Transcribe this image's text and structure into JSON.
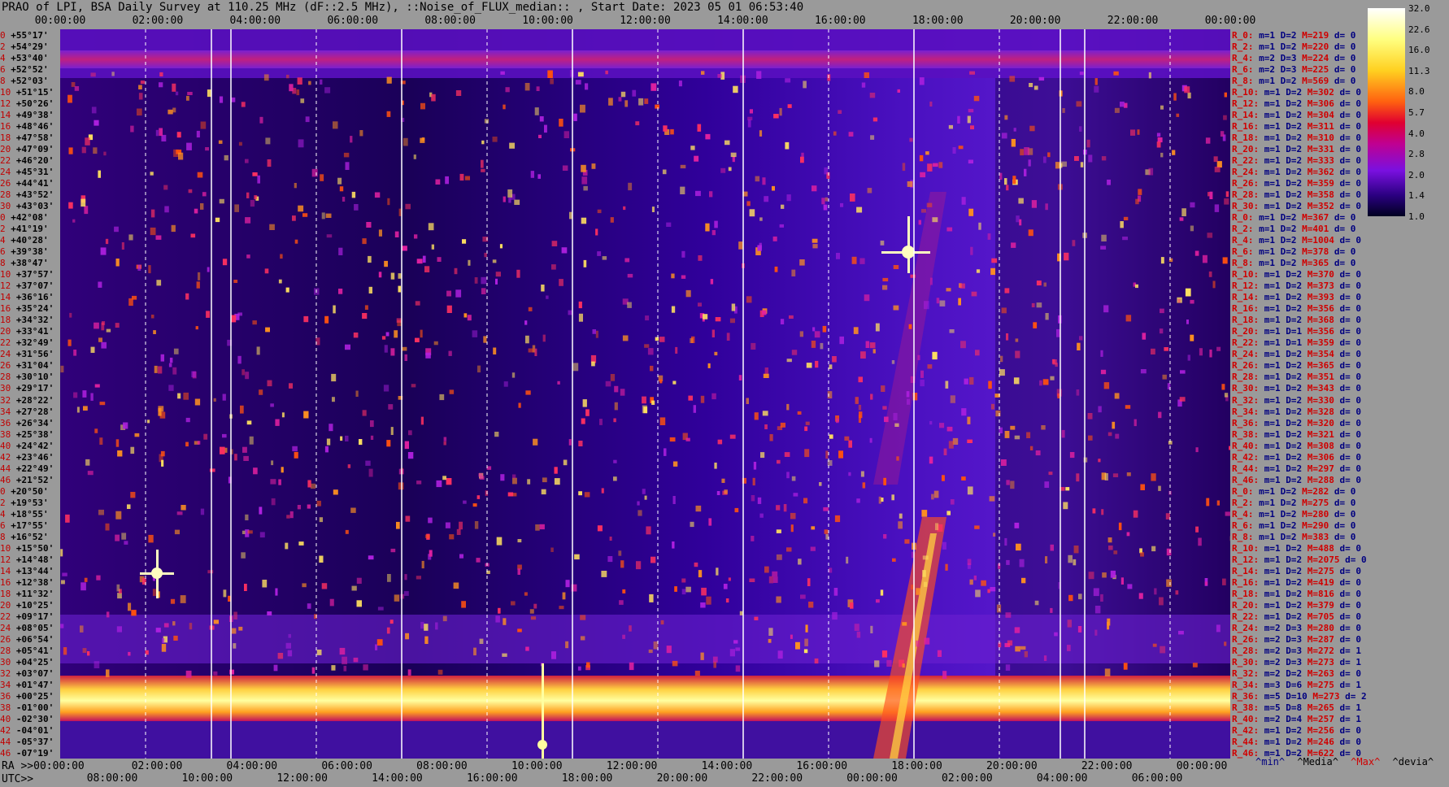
{
  "title": "PRAO of LPI, BSA Daily Survey at 110.25 MHz (dF::2.5 MHz), ::Noise_of_FLUX_median:: , Start Date: 2023 05 01 06:53:40",
  "chart_data": {
    "type": "heatmap",
    "title": "PRAO of LPI, BSA Daily Survey at 110.25 MHz (dF::2.5 MHz), ::Noise_of_FLUX_median:: , Start Date: 2023 05 01 06:53:40",
    "x_top_ticks": [
      "00:00:00",
      "02:00:00",
      "04:00:00",
      "06:00:00",
      "08:00:00",
      "10:00:00",
      "12:00:00",
      "14:00:00",
      "16:00:00",
      "18:00:00",
      "20:00:00",
      "22:00:00",
      "00:00:00"
    ],
    "ra_label": "RA >>00:00:00",
    "ra_ticks": [
      "02:00:00",
      "04:00:00",
      "06:00:00",
      "08:00:00",
      "10:00:00",
      "12:00:00",
      "14:00:00",
      "16:00:00",
      "18:00:00",
      "20:00:00",
      "22:00:00",
      "00:00:00"
    ],
    "utc_label": "UTC>>",
    "utc_ticks": [
      "08:00:00",
      "10:00:00",
      "12:00:00",
      "14:00:00",
      "16:00:00",
      "18:00:00",
      "20:00:00",
      "22:00:00",
      "00:00:00",
      "02:00:00",
      "04:00:00",
      "06:00:00"
    ],
    "colorbar_ticks": [
      "32.0",
      "22.6",
      "16.0",
      "11.3",
      "8.0",
      "5.7",
      "4.0",
      "2.8",
      "2.0",
      "1.4",
      "1.0"
    ],
    "declinations": [
      "+55°17'",
      "+54°29'",
      "+53°40'",
      "+52°52'",
      "+52°03'",
      "+51°15'",
      "+50°26'",
      "+49°38'",
      "+48°46'",
      "+47°58'",
      "+47°09'",
      "+46°20'",
      "+45°31'",
      "+44°41'",
      "+43°52'",
      "+43°03'",
      "+42°08'",
      "+41°19'",
      "+40°28'",
      "+39°38'",
      "+38°47'",
      "+37°57'",
      "+37°07'",
      "+36°16'",
      "+35°24'",
      "+34°32'",
      "+33°41'",
      "+32°49'",
      "+31°56'",
      "+31°04'",
      "+30°10'",
      "+29°17'",
      "+28°22'",
      "+27°28'",
      "+26°34'",
      "+25°38'",
      "+24°42'",
      "+23°46'",
      "+22°49'",
      "+21°52'",
      "+20°50'",
      "+19°53'",
      "+18°55'",
      "+17°55'",
      "+16°52'",
      "+15°50'",
      "+14°48'",
      "+13°44'",
      "+12°38'",
      "+11°32'",
      "+10°25'",
      "+09°17'",
      "+08°05'",
      "+06°54'",
      "+05°41'",
      "+04°25'",
      "+03°07'",
      "+01°47'",
      "+00°25'",
      "-01°00'",
      "-02°30'",
      "-04°01'",
      "-05°37'",
      "-07°19'"
    ],
    "beam_index": [
      "0",
      "2",
      "4",
      "6",
      "8",
      "10",
      "12",
      "14",
      "16",
      "18",
      "20",
      "22",
      "24",
      "26",
      "28",
      "30",
      "0",
      "2",
      "4",
      "6",
      "8",
      "10",
      "12",
      "14",
      "16",
      "18",
      "20",
      "22",
      "24",
      "26",
      "28",
      "30",
      "32",
      "34",
      "36",
      "38",
      "40",
      "42",
      "44",
      "46",
      "0",
      "2",
      "4",
      "6",
      "8",
      "10",
      "12",
      "14",
      "16",
      "18",
      "20",
      "22",
      "24",
      "26",
      "28",
      "30",
      "32",
      "34",
      "36",
      "38",
      "40",
      "42",
      "44",
      "46"
    ],
    "rows": [
      {
        "r": "R_0:",
        "m": "m=1",
        "D": "D=2",
        "M": "M=219",
        "d": "d= 0"
      },
      {
        "r": "R_2:",
        "m": "m=1",
        "D": "D=2",
        "M": "M=220",
        "d": "d= 0"
      },
      {
        "r": "R_4:",
        "m": "m=2",
        "D": "D=3",
        "M": "M=224",
        "d": "d= 0"
      },
      {
        "r": "R_6:",
        "m": "m=2",
        "D": "D=3",
        "M": "M=225",
        "d": "d= 0"
      },
      {
        "r": "R_8:",
        "m": "m=1",
        "D": "D=2",
        "M": "M=569",
        "d": "d= 0"
      },
      {
        "r": "R_10:",
        "m": "m=1",
        "D": "D=2",
        "M": "M=302",
        "d": "d= 0"
      },
      {
        "r": "R_12:",
        "m": "m=1",
        "D": "D=2",
        "M": "M=306",
        "d": "d= 0"
      },
      {
        "r": "R_14:",
        "m": "m=1",
        "D": "D=2",
        "M": "M=304",
        "d": "d= 0"
      },
      {
        "r": "R_16:",
        "m": "m=1",
        "D": "D=2",
        "M": "M=311",
        "d": "d= 0"
      },
      {
        "r": "R_18:",
        "m": "m=1",
        "D": "D=2",
        "M": "M=310",
        "d": "d= 0"
      },
      {
        "r": "R_20:",
        "m": "m=1",
        "D": "D=2",
        "M": "M=331",
        "d": "d= 0"
      },
      {
        "r": "R_22:",
        "m": "m=1",
        "D": "D=2",
        "M": "M=333",
        "d": "d= 0"
      },
      {
        "r": "R_24:",
        "m": "m=1",
        "D": "D=2",
        "M": "M=362",
        "d": "d= 0"
      },
      {
        "r": "R_26:",
        "m": "m=1",
        "D": "D=2",
        "M": "M=359",
        "d": "d= 0"
      },
      {
        "r": "R_28:",
        "m": "m=1",
        "D": "D=2",
        "M": "M=358",
        "d": "d= 0"
      },
      {
        "r": "R_30:",
        "m": "m=1",
        "D": "D=2",
        "M": "M=352",
        "d": "d= 0"
      },
      {
        "r": "R_0:",
        "m": "m=1",
        "D": "D=2",
        "M": "M=367",
        "d": "d= 0"
      },
      {
        "r": "R_2:",
        "m": "m=1",
        "D": "D=2",
        "M": "M=401",
        "d": "d= 0"
      },
      {
        "r": "R_4:",
        "m": "m=1",
        "D": "D=2",
        "M": "M=1004",
        "d": "d= 0"
      },
      {
        "r": "R_6:",
        "m": "m=1",
        "D": "D=2",
        "M": "M=378",
        "d": "d= 0"
      },
      {
        "r": "R_8:",
        "m": "m=1",
        "D": "D=2",
        "M": "M=365",
        "d": "d= 0"
      },
      {
        "r": "R_10:",
        "m": "m=1",
        "D": "D=2",
        "M": "M=370",
        "d": "d= 0"
      },
      {
        "r": "R_12:",
        "m": "m=1",
        "D": "D=2",
        "M": "M=373",
        "d": "d= 0"
      },
      {
        "r": "R_14:",
        "m": "m=1",
        "D": "D=2",
        "M": "M=393",
        "d": "d= 0"
      },
      {
        "r": "R_16:",
        "m": "m=1",
        "D": "D=2",
        "M": "M=356",
        "d": "d= 0"
      },
      {
        "r": "R_18:",
        "m": "m=1",
        "D": "D=2",
        "M": "M=368",
        "d": "d= 0"
      },
      {
        "r": "R_20:",
        "m": "m=1",
        "D": "D=1",
        "M": "M=356",
        "d": "d= 0"
      },
      {
        "r": "R_22:",
        "m": "m=1",
        "D": "D=1",
        "M": "M=359",
        "d": "d= 0"
      },
      {
        "r": "R_24:",
        "m": "m=1",
        "D": "D=2",
        "M": "M=354",
        "d": "d= 0"
      },
      {
        "r": "R_26:",
        "m": "m=1",
        "D": "D=2",
        "M": "M=365",
        "d": "d= 0"
      },
      {
        "r": "R_28:",
        "m": "m=1",
        "D": "D=2",
        "M": "M=351",
        "d": "d= 0"
      },
      {
        "r": "R_30:",
        "m": "m=1",
        "D": "D=2",
        "M": "M=343",
        "d": "d= 0"
      },
      {
        "r": "R_32:",
        "m": "m=1",
        "D": "D=2",
        "M": "M=330",
        "d": "d= 0"
      },
      {
        "r": "R_34:",
        "m": "m=1",
        "D": "D=2",
        "M": "M=328",
        "d": "d= 0"
      },
      {
        "r": "R_36:",
        "m": "m=1",
        "D": "D=2",
        "M": "M=320",
        "d": "d= 0"
      },
      {
        "r": "R_38:",
        "m": "m=1",
        "D": "D=2",
        "M": "M=321",
        "d": "d= 0"
      },
      {
        "r": "R_40:",
        "m": "m=1",
        "D": "D=2",
        "M": "M=308",
        "d": "d= 0"
      },
      {
        "r": "R_42:",
        "m": "m=1",
        "D": "D=2",
        "M": "M=306",
        "d": "d= 0"
      },
      {
        "r": "R_44:",
        "m": "m=1",
        "D": "D=2",
        "M": "M=297",
        "d": "d= 0"
      },
      {
        "r": "R_46:",
        "m": "m=1",
        "D": "D=2",
        "M": "M=288",
        "d": "d= 0"
      },
      {
        "r": "R_0:",
        "m": "m=1",
        "D": "D=2",
        "M": "M=282",
        "d": "d= 0"
      },
      {
        "r": "R_2:",
        "m": "m=1",
        "D": "D=2",
        "M": "M=275",
        "d": "d= 0"
      },
      {
        "r": "R_4:",
        "m": "m=1",
        "D": "D=2",
        "M": "M=280",
        "d": "d= 0"
      },
      {
        "r": "R_6:",
        "m": "m=1",
        "D": "D=2",
        "M": "M=290",
        "d": "d= 0"
      },
      {
        "r": "R_8:",
        "m": "m=1",
        "D": "D=2",
        "M": "M=383",
        "d": "d= 0"
      },
      {
        "r": "R_10:",
        "m": "m=1",
        "D": "D=2",
        "M": "M=488",
        "d": "d= 0"
      },
      {
        "r": "R_12:",
        "m": "m=1",
        "D": "D=2",
        "M": "M=2075",
        "d": "d= 0"
      },
      {
        "r": "R_14:",
        "m": "m=1",
        "D": "D=2",
        "M": "M=275",
        "d": "d= 0"
      },
      {
        "r": "R_16:",
        "m": "m=1",
        "D": "D=2",
        "M": "M=419",
        "d": "d= 0"
      },
      {
        "r": "R_18:",
        "m": "m=1",
        "D": "D=2",
        "M": "M=816",
        "d": "d= 0"
      },
      {
        "r": "R_20:",
        "m": "m=1",
        "D": "D=2",
        "M": "M=379",
        "d": "d= 0"
      },
      {
        "r": "R_22:",
        "m": "m=1",
        "D": "D=2",
        "M": "M=705",
        "d": "d= 0"
      },
      {
        "r": "R_24:",
        "m": "m=2",
        "D": "D=3",
        "M": "M=280",
        "d": "d= 0"
      },
      {
        "r": "R_26:",
        "m": "m=2",
        "D": "D=3",
        "M": "M=287",
        "d": "d= 0"
      },
      {
        "r": "R_28:",
        "m": "m=2",
        "D": "D=3",
        "M": "M=272",
        "d": "d= 1"
      },
      {
        "r": "R_30:",
        "m": "m=2",
        "D": "D=3",
        "M": "M=273",
        "d": "d= 1"
      },
      {
        "r": "R_32:",
        "m": "m=2",
        "D": "D=2",
        "M": "M=263",
        "d": "d= 0"
      },
      {
        "r": "R_34:",
        "m": "m=3",
        "D": "D=6",
        "M": "M=275",
        "d": "d= 1"
      },
      {
        "r": "R_36:",
        "m": "m=5",
        "D": "D=10",
        "M": "M=273",
        "d": "d= 2"
      },
      {
        "r": "R_38:",
        "m": "m=5",
        "D": "D=8",
        "M": "M=265",
        "d": "d= 1"
      },
      {
        "r": "R_40:",
        "m": "m=2",
        "D": "D=4",
        "M": "M=257",
        "d": "d= 1"
      },
      {
        "r": "R_42:",
        "m": "m=1",
        "D": "D=2",
        "M": "M=256",
        "d": "d= 0"
      },
      {
        "r": "R_44:",
        "m": "m=1",
        "D": "D=2",
        "M": "M=246",
        "d": "d= 0"
      },
      {
        "r": "R_46:",
        "m": "m=1",
        "D": "D=2",
        "M": "M=622",
        "d": "d= 0"
      }
    ]
  },
  "legend": {
    "min": "^min^",
    "media": "^Media^",
    "max": "^Max^",
    "devia": "^devia^"
  },
  "colors": {
    "background": "#9a9a9a",
    "label_red": "#d00000",
    "label_blue": "#000080"
  }
}
